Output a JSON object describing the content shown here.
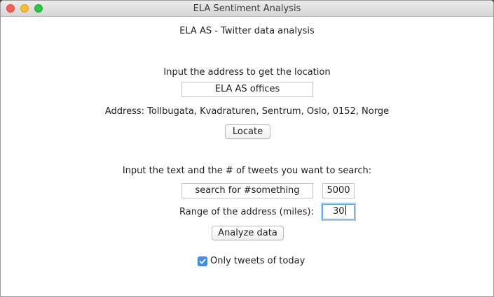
{
  "window": {
    "title": "ELA Sentiment Analysis"
  },
  "main": {
    "heading": "ELA AS - Twitter data analysis",
    "address_prompt": "Input the address to get the location",
    "address_input": {
      "value": "ELA AS offices"
    },
    "address_result": "Address: Tollbugata, Kvadraturen, Sentrum, Oslo, 0152, Norge",
    "locate_label": "Locate",
    "search_prompt": "Input the text and the # of tweets you want to search:",
    "search_input": {
      "value": "search for #something"
    },
    "count_input": {
      "value": "5000"
    },
    "range_label": "Range of the address (miles):",
    "range_input": {
      "value": "30"
    },
    "analyze_label": "Analyze data",
    "today_checkbox": {
      "label": "Only tweets of today",
      "checked": true
    }
  },
  "colors": {
    "accent": "#3d8ff0",
    "focus_ring": "#5b9de6"
  },
  "icons": {
    "close": "close-icon",
    "minimize": "minimize-icon",
    "maximize": "maximize-icon",
    "check": "checkmark-icon"
  }
}
